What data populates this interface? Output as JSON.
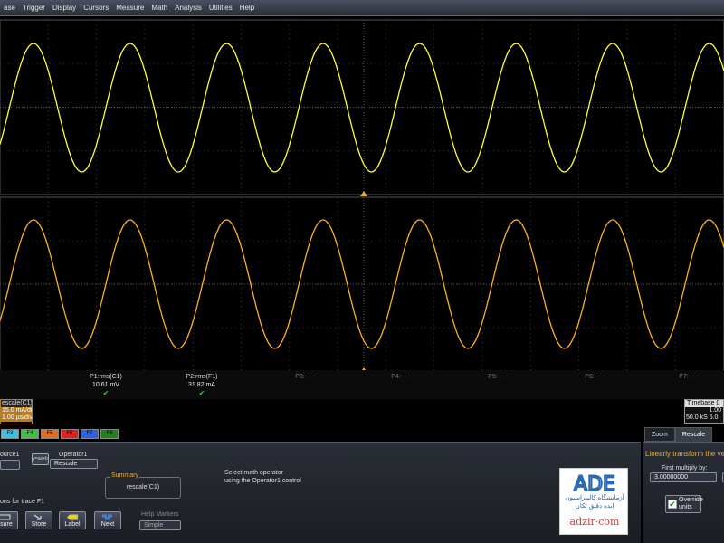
{
  "menu": [
    "ase",
    "Trigger",
    "Display",
    "Cursors",
    "Measure",
    "Math",
    "Analysis",
    "Utilities",
    "Help"
  ],
  "colors": {
    "trace_c1": "#ffff33",
    "trace_f1": "#ffb020",
    "grid": "#3a3a3a",
    "accent": "#e0b040"
  },
  "waves": {
    "cycles_visible": 7.5,
    "upper_trace": "C1",
    "lower_trace": "F1"
  },
  "params": [
    {
      "label": "P1:rms(C1)",
      "value": "10.61 mV",
      "ok": "✔"
    },
    {
      "label": "P2:rms(F1)",
      "value": "31.82 mA",
      "ok": "✔"
    },
    {
      "label": "P3:- - -",
      "value": "",
      "ok": ""
    },
    {
      "label": "P4:- - -",
      "value": "",
      "ok": ""
    },
    {
      "label": "P5:- - -",
      "value": "",
      "ok": ""
    },
    {
      "label": "P6:- - -",
      "value": "",
      "ok": ""
    },
    {
      "label": "P7:- - -",
      "value": "",
      "ok": ""
    }
  ],
  "trace_desc": {
    "title": "escale(C1)",
    "vdiv": "15.0 mA/div",
    "hdiv": "1.00 µs/div"
  },
  "timebase": {
    "title": "Timebase",
    "title_val": "0",
    "row1": "1.00",
    "row2a": "50.0 kS",
    "row2b": "5.0"
  },
  "trace_tabs": [
    {
      "label": "F3",
      "color": "#40c0e0"
    },
    {
      "label": "F4",
      "color": "#40c040"
    },
    {
      "label": "F5",
      "color": "#e07020"
    },
    {
      "label": "F6",
      "color": "#e02020"
    },
    {
      "label": "F7",
      "color": "#3060e0"
    },
    {
      "label": "F8",
      "color": "#208020"
    }
  ],
  "right_tabs": [
    "Zoom",
    "Rescale"
  ],
  "panel": {
    "source_label": "ource1",
    "operator_label": "Operator1",
    "operator_value": "Rescale",
    "operator_btn": "y=ax+b",
    "summary_title": "Summary",
    "summary_value": "rescale(C1)",
    "hint1": "Select math operator",
    "hint2": "using the Operator1 control",
    "trace_label": "ons for trace F1",
    "help_markers_label": "Help Markers",
    "help_markers_value": "Simple",
    "buttons": [
      "asure",
      "Store",
      "Label",
      "Next"
    ]
  },
  "rpanel": {
    "title": "Linearly transform the vertic",
    "multiply_label": "First multiply by:",
    "multiply_value": "3.00000000",
    "override_label1": "Override",
    "override_label2": "units",
    "override_checked": "✔"
  },
  "logo": {
    "mark": "ADE",
    "fa1": "آزمایشگاه کالیبراسیون",
    "fa2": "ایده دقیق تکان",
    "url": "adzir·com"
  }
}
